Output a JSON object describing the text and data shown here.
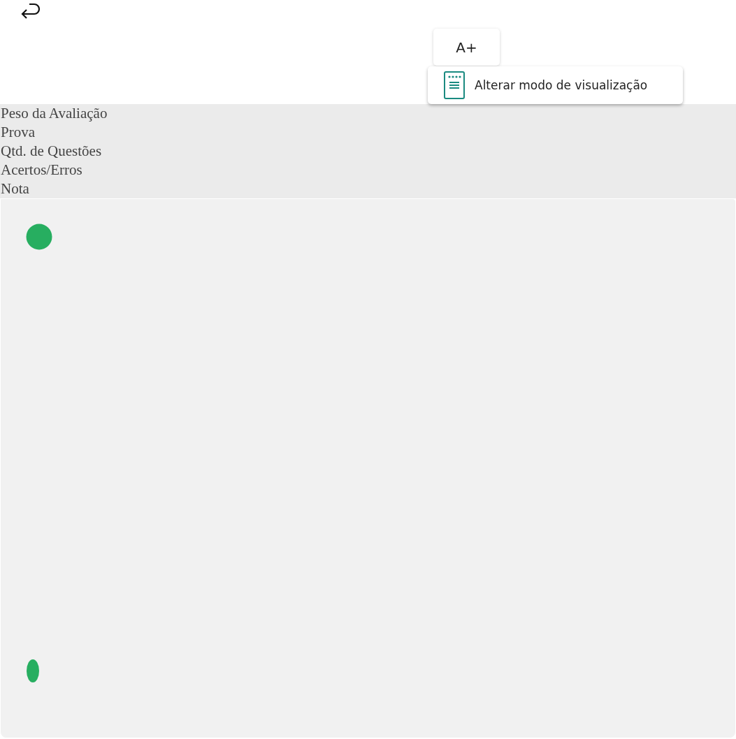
{
  "header": {
    "font_button": "A+",
    "menu_items": [
      "Alterar modo de visualização"
    ]
  },
  "labels": [
    "Peso da Avaliação",
    "Prova",
    "Qtd. de Questões",
    "Acertos/Erros",
    "Nota"
  ]
}
